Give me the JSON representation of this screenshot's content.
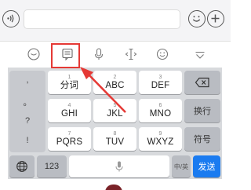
{
  "toolbar": {
    "icons": [
      "emoji-keyboard-icon",
      "message-icon",
      "microphone-icon",
      "cursor-move-icon",
      "smiley-icon",
      "collapse-keyboard-icon"
    ]
  },
  "keyboard": {
    "punctuation": [
      ",",
      "。",
      "?",
      "!"
    ],
    "keys": [
      {
        "digit": "1",
        "letters": "分词"
      },
      {
        "digit": "2",
        "letters": "ABC"
      },
      {
        "digit": "3",
        "letters": "DEF"
      },
      {
        "digit": "4",
        "letters": "GHI"
      },
      {
        "digit": "5",
        "letters": "JKL"
      },
      {
        "digit": "6",
        "letters": "MNO"
      },
      {
        "digit": "7",
        "letters": "PQRS"
      },
      {
        "digit": "8",
        "letters": "TUV"
      },
      {
        "digit": "9",
        "letters": "WXYZ"
      }
    ],
    "linebreak_label": "换行",
    "symbol_label": "符号",
    "numbers_label": "123",
    "lang_switch_label": "中/英",
    "send_label": "发送"
  },
  "colors": {
    "accent": "#1a7bf0",
    "annotation": "#e53935"
  }
}
